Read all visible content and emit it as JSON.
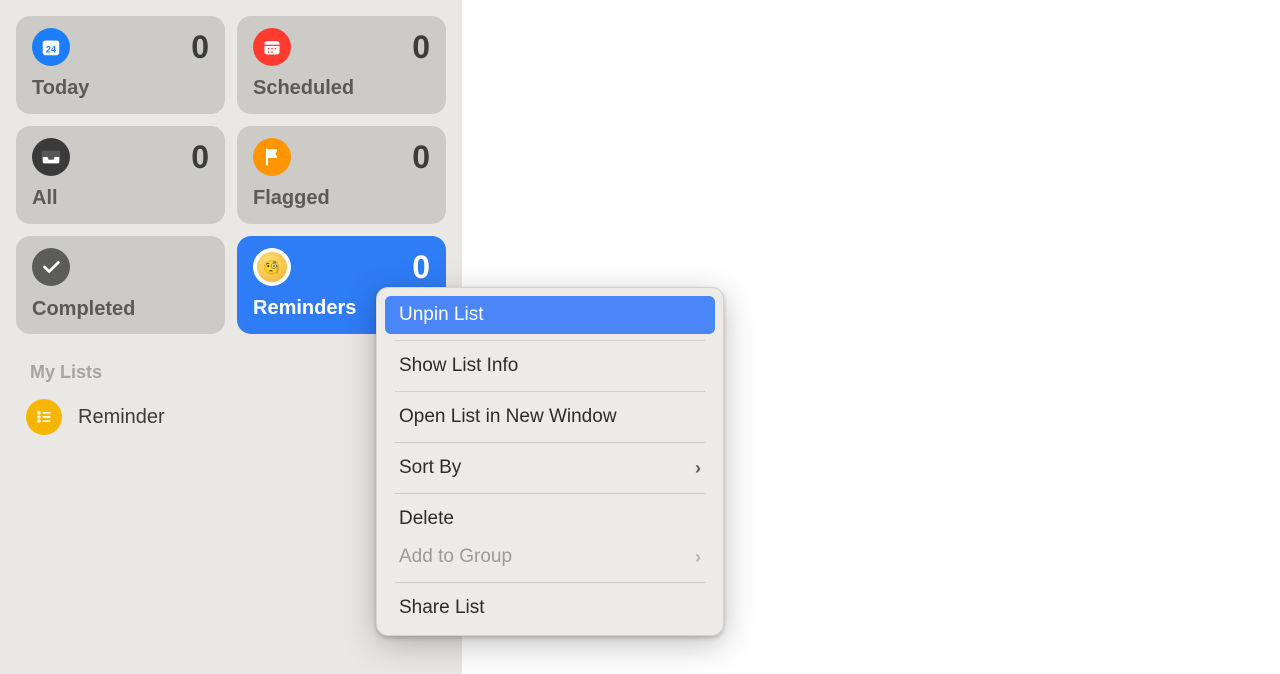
{
  "sidebar": {
    "cards": {
      "today": {
        "label": "Today",
        "count": "0",
        "icon": "calendar-icon",
        "bg": "#1c7df9"
      },
      "scheduled": {
        "label": "Scheduled",
        "count": "0",
        "icon": "calendar-red-icon",
        "bg": "#ff3b30"
      },
      "all": {
        "label": "All",
        "count": "0",
        "icon": "tray-icon",
        "bg": "#3a3a3a"
      },
      "flagged": {
        "label": "Flagged",
        "count": "0",
        "icon": "flag-icon",
        "bg": "#ff9500"
      },
      "completed": {
        "label": "Completed",
        "icon": "check-icon",
        "bg": "#5c5c5a"
      },
      "reminders": {
        "label": "Reminders",
        "count": "0",
        "icon": "emoji-icon",
        "selected": true
      }
    },
    "sectionHeader": "My Lists",
    "lists": [
      {
        "label": "Reminder",
        "color": "#f7b500"
      }
    ]
  },
  "contextMenu": {
    "items": {
      "unpin": {
        "label": "Unpin List",
        "highlighted": true
      },
      "info": {
        "label": "Show List Info"
      },
      "openWindow": {
        "label": "Open List in New Window"
      },
      "sortBy": {
        "label": "Sort By",
        "submenu": true
      },
      "delete": {
        "label": "Delete"
      },
      "addGroup": {
        "label": "Add to Group",
        "submenu": true,
        "disabled": true
      },
      "share": {
        "label": "Share List"
      }
    }
  }
}
